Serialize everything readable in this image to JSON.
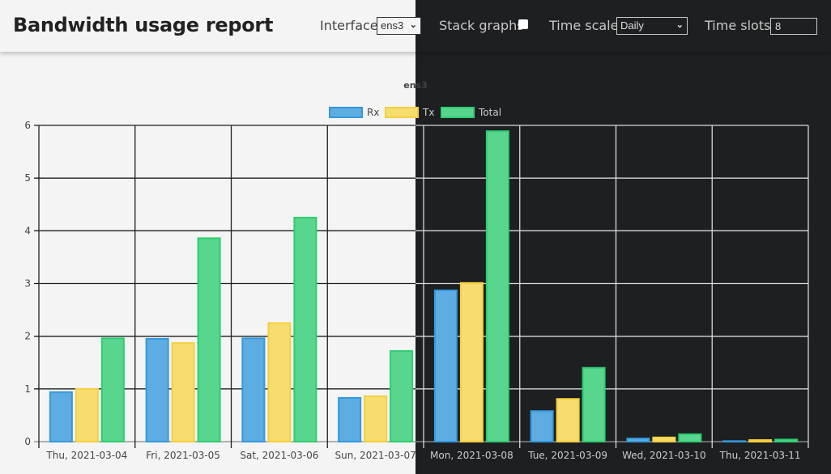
{
  "header": {
    "title": "Bandwidth usage report",
    "interface_label": "Interface:",
    "interface_value": "ens3",
    "stack_label": "Stack graphs",
    "stack_checked": false,
    "timescale_label": "Time scale:",
    "timescale_value": "Daily",
    "timeslots_label": "Time slots:",
    "timeslots_value": "8"
  },
  "icons": {
    "dropdown": "chevron-down-icon"
  },
  "colors": {
    "rx_fill": "#5dade2",
    "rx_border": "#3498db",
    "tx_fill": "#f7dc6f",
    "tx_border": "#f4d03f",
    "total_fill": "#58d68d",
    "total_border": "#2ecc71",
    "light_bg": "#f4f4f4",
    "dark_bg": "#1e1f21"
  },
  "chart_data": {
    "type": "bar",
    "title": "ens3",
    "categories": [
      "Thu, 2021-03-04",
      "Fri, 2021-03-05",
      "Sat, 2021-03-06",
      "Sun, 2021-03-07",
      "Mon, 2021-03-08",
      "Tue, 2021-03-09",
      "Wed, 2021-03-10",
      "Thu, 2021-03-11"
    ],
    "series": [
      {
        "name": "Rx",
        "values": [
          0.94,
          1.95,
          1.96,
          0.83,
          2.87,
          0.58,
          0.06,
          0.01
        ]
      },
      {
        "name": "Tx",
        "values": [
          1.0,
          1.87,
          2.25,
          0.86,
          3.01,
          0.81,
          0.08,
          0.03
        ]
      },
      {
        "name": "Total",
        "values": [
          1.96,
          3.86,
          4.25,
          1.72,
          5.89,
          1.4,
          0.14,
          0.04
        ]
      }
    ],
    "yticks": [
      "0",
      "1",
      "2",
      "3",
      "4",
      "5",
      "6"
    ],
    "ylim": [
      0,
      6
    ],
    "xlabel": "",
    "ylabel": "",
    "grid": true,
    "legend": "top-center",
    "stacked": false
  }
}
